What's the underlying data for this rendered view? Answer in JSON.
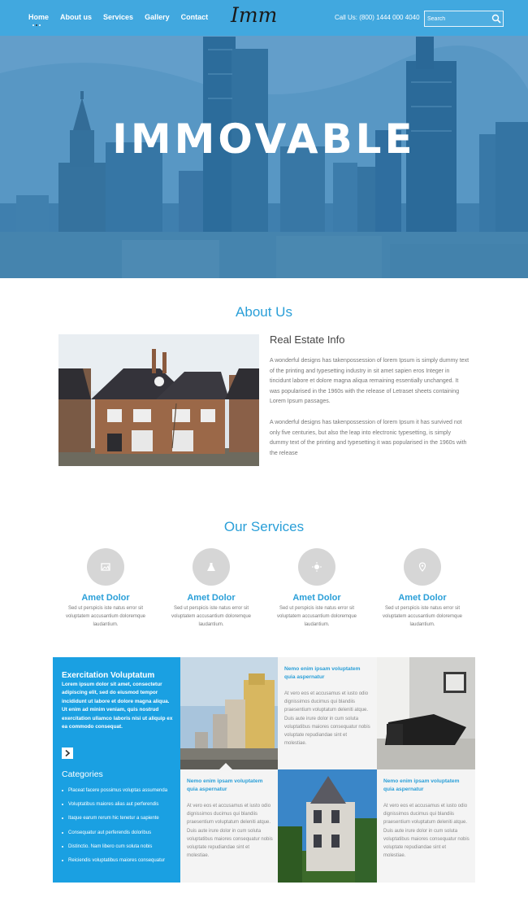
{
  "nav": {
    "items": [
      {
        "label": "Home",
        "active": true
      },
      {
        "label": "About us"
      },
      {
        "label": "Services"
      },
      {
        "label": "Gallery"
      },
      {
        "label": "Contact"
      }
    ],
    "logo": "Imm",
    "call_label": "Call Us: (800) 1444 000 4040",
    "search_placeholder": "Search"
  },
  "hero": {
    "title": "IMMOVABLE"
  },
  "about": {
    "title": "About Us",
    "subtitle": "Real Estate Info",
    "para1": "A wonderful designs has takenpossession of lorem Ipsum is simply dummy text of the printing and typesetting industry in sit amet sapien eros Integer in tincidunt labore et dolore magna aliqua remaining essentially unchanged. It was popularised in the 1960s with the release of Letraset sheets containing Lorem Ipsum passages.",
    "para2": "A wonderful designs has takenpossession of lorem Ipsum it has survived not only five centuries, but also the leap into electronic typesetting, is simply dummy text of the printing and typesetting it was popularised in the 1960s with the release"
  },
  "services": {
    "title": "Our Services",
    "items": [
      {
        "title": "Amet Dolor",
        "text": "Sed ut perspicis iste natus error sit voluptatem accusantium doloremque laudantium.",
        "icon": "image-icon"
      },
      {
        "title": "Amet Dolor",
        "text": "Sed ut perspicis iste natus error sit voluptatem accusantium doloremque laudantium.",
        "icon": "flask-icon"
      },
      {
        "title": "Amet Dolor",
        "text": "Sed ut perspicis iste natus error sit voluptatem accusantium doloremque laudantium.",
        "icon": "sun-icon"
      },
      {
        "title": "Amet Dolor",
        "text": "Sed ut perspicis iste natus error sit voluptatem accusantium doloremque laudantium.",
        "icon": "map-pin-icon"
      }
    ]
  },
  "panel": {
    "heading": "Exercitation Voluptatum",
    "text": "Lorem ipsum dolor sit amet, consectetur adipiscing elit, sed do eiusmod tempor incididunt ut labore et dolore magna aliqua. Ut enim ad minim veniam, quis nostrud exercitation ullamco laboris nisi ut aliquip ex ea commodo consequat.",
    "categories_title": "Categories",
    "categories": [
      "Placeat facere possimus voluptas assumenda",
      "Voluptatibus maiores alias aut perferendis",
      "Itaque earum rerum hic tenetur a sapiente",
      "Consequatur aut perferendis doloribus",
      "Distinctio. Nam libero cum soluta nobis",
      "Reiciendis voluptatibus maiores consequatur"
    ]
  },
  "tiles": [
    {
      "heading": "Nemo enim ipsam voluptatem quia aspernatur",
      "text": "At vero eos et accusamus et iusto odio dignissimos ducimus qui blandiis praesentium voluptatum deleniti atque. Duis aute irure dolor in cum soluta voluptatibus maiores consequatur nobis voluptate repudiandae sint et molestiae."
    },
    {
      "heading": "Nemo enim ipsam voluptatem quia aspernatur",
      "text": "At vero eos et accusamus et iusto odio dignissimos ducimus qui blandiis praesentium voluptatum deleniti atque. Duis aute irure dolor in cum soluta voluptatibus maiores consequatur nobis voluptate repudiandae sint et molestiae."
    },
    {
      "heading": "Nemo enim ipsam voluptatem quia aspernatur",
      "text": "At vero eos et accusamus et iusto odio dignissimos ducimus qui blandiis praesentium voluptatum deleniti atque. Duis aute irure dolor in cum soluta voluptatibus maiores consequatur nobis voluptate repudiandae sint et molestiae."
    }
  ],
  "colors": {
    "accent": "#2a9fd8",
    "panel": "#1aa0e2",
    "nav": "#3caae1"
  }
}
